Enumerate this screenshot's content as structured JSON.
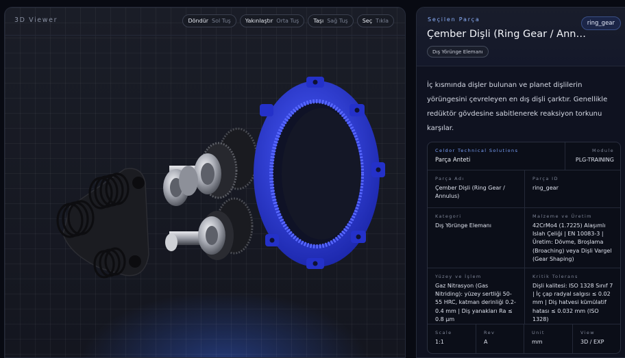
{
  "viewer": {
    "title": "3D Viewer",
    "controls": [
      {
        "action": "Döndür",
        "key": "Sol Tuş"
      },
      {
        "action": "Yakınlaştır",
        "key": "Orta Tuş"
      },
      {
        "action": "Taşı",
        "key": "Sağ Tuş"
      },
      {
        "action": "Seç",
        "key": "Tıkla"
      }
    ]
  },
  "info": {
    "eyebrow": "Seçilen Parça",
    "part_id_badge": "ring_gear",
    "title": "Çember Dişli (Ring Gear / Annulus)",
    "category_badge": "Dış Yörünge Elemanı",
    "description": "İç kısmında dişler bulunan ve planet dişlilerin yörüngesini çevreleyen en dış dişli çarktır. Genellikle redüktör gövdesine sabitlenerek reaksiyon torkunu karşılar.",
    "card": {
      "company_label": "Celdor Technical Solutions",
      "company_value": "Parça Anteti",
      "module_label": "Module",
      "module_value": "PLG-TRAINING",
      "name_label": "Parça Adı",
      "name_value": "Çember Dişli (Ring Gear / Annulus)",
      "id_label": "Parça ID",
      "id_value": "ring_gear",
      "category_label": "Kategori",
      "category_value": "Dış Yörünge Elemanı",
      "material_label": "Malzeme ve Üretim",
      "material_value": "42CrMo4 (1.7225) Alaşımlı Islah Çeliği | EN 10083-3 | Üretim: Dövme, Broşlama (Broaching) veya Dişli Vargel (Gear Shaping)",
      "surface_label": "Yüzey ve İşlem",
      "surface_value": "Gaz Nitrasyon (Gas Nitriding): yüzey sertliği 50-55 HRC, katman derinliği 0.2-0.4 mm | Diş yanakları Ra ≤ 0.8 µm",
      "tolerance_label": "Kritik Tolerans",
      "tolerance_value": "Dişli kalitesi: ISO 1328 Sınıf 7 | İç çap radyal salgısı ≤ 0.02 mm | Diş hatvesi kümülatif hatası ≤ 0.032 mm (ISO 1328)",
      "footer": [
        {
          "label": "Scale",
          "value": "1:1"
        },
        {
          "label": "Rev",
          "value": "A"
        },
        {
          "label": "Unit",
          "value": "mm"
        },
        {
          "label": "View",
          "value": "3D / EXP"
        }
      ]
    }
  },
  "colors": {
    "ring_gear": "#2b3bd8",
    "accent": "#8fb4ff",
    "gear_metal": "#b9bcc4",
    "spring": "#0d0d10",
    "carrier": "#1b1c21"
  }
}
